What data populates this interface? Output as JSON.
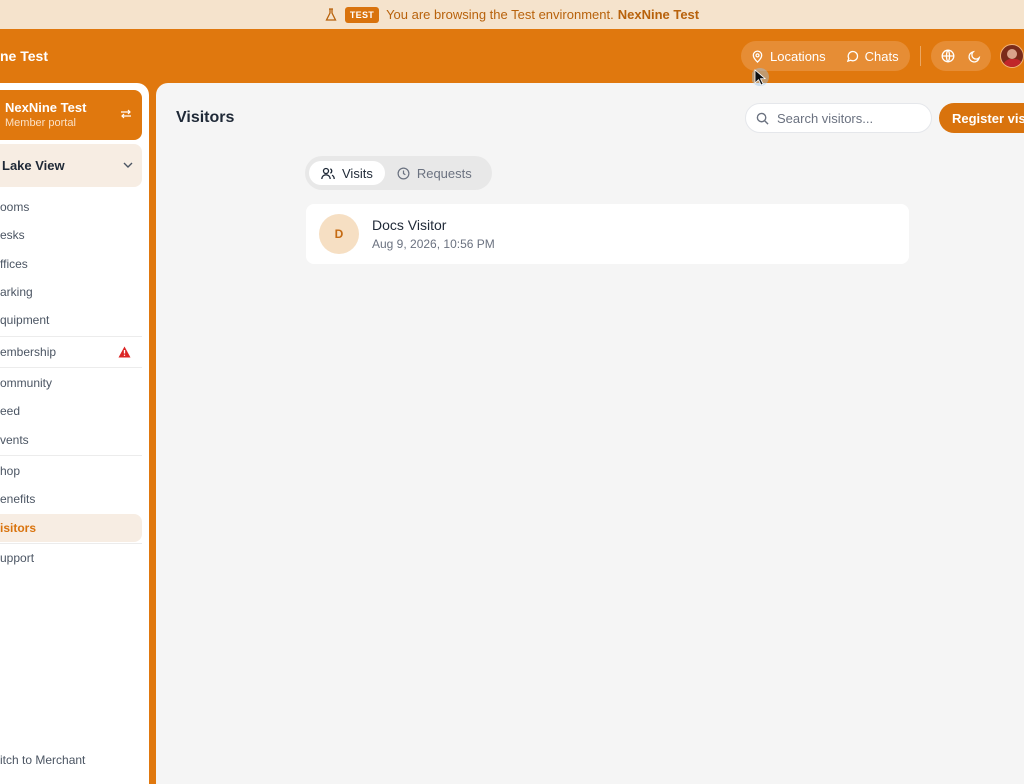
{
  "banner": {
    "badge": "TEST",
    "message": "You are browsing the Test environment.",
    "brand": "NexNine Test"
  },
  "topbar": {
    "app_title": "ne Test",
    "locations_label": "Locations",
    "chats_label": "Chats"
  },
  "sidebar": {
    "org": {
      "name": "NexNine Test",
      "subtitle": "Member portal"
    },
    "location": "Lake View",
    "items": [
      {
        "label": "ooms"
      },
      {
        "label": "esks"
      },
      {
        "label": "ffices"
      },
      {
        "label": "arking"
      },
      {
        "label": "quipment"
      },
      {
        "label": "embership",
        "warning": true
      },
      {
        "label": "ommunity"
      },
      {
        "label": "eed"
      },
      {
        "label": "vents"
      },
      {
        "label": "hop"
      },
      {
        "label": "enefits"
      },
      {
        "label": "isitors",
        "active": true
      },
      {
        "label": "upport"
      }
    ],
    "switch_label": "itch to Merchant"
  },
  "main": {
    "title": "Visitors",
    "search_placeholder": "Search visitors...",
    "register_label": "Register visit",
    "tabs": [
      {
        "label": "Visits",
        "active": true
      },
      {
        "label": "Requests",
        "active": false
      }
    ],
    "visits": [
      {
        "initial": "D",
        "name": "Docs Visitor",
        "time": "Aug 9, 2026, 10:56 PM"
      }
    ]
  },
  "colors": {
    "brand": "#e0780e",
    "accent": "#d9730d",
    "banner_bg": "#f5e3cc",
    "warning": "#dc2626"
  }
}
